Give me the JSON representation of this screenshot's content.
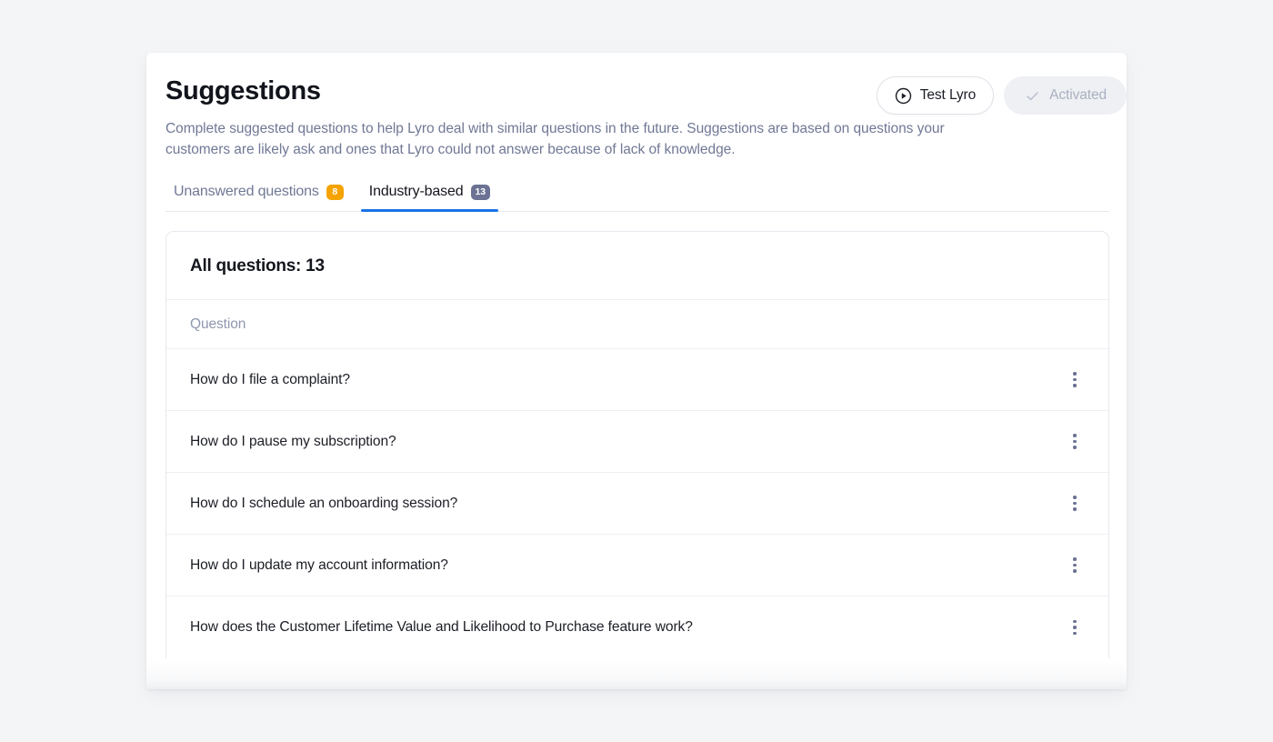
{
  "theme": {
    "page_background": "#f4f5f7",
    "accent": "#1a73e8",
    "badge_warning": "#f5a300",
    "badge_slate": "#6b7294",
    "text_primary": "#14161d",
    "text_muted": "#707895"
  },
  "header": {
    "title": "Suggestions",
    "description": "Complete suggested questions to help Lyro deal with similar questions in the future. Suggestions are based on questions your customers are likely ask and ones that Lyro could not answer because of lack of knowledge.",
    "actions": {
      "test": {
        "label": "Test Lyro",
        "icon": "play-circle-icon"
      },
      "activated": {
        "label": "Activated",
        "icon": "check-icon",
        "disabled": true
      }
    }
  },
  "tabs": [
    {
      "label": "Unanswered questions",
      "badge": "8",
      "badge_style": "warning",
      "active": false
    },
    {
      "label": "Industry-based",
      "badge": "13",
      "badge_style": "slate",
      "active": true
    }
  ],
  "table": {
    "title": "All questions: 13",
    "column_header": "Question",
    "rows": [
      {
        "question": "How do I file a complaint?",
        "menu_icon": "kebab-menu-icon"
      },
      {
        "question": "How do I pause my subscription?",
        "menu_icon": "kebab-menu-icon"
      },
      {
        "question": "How do I schedule an onboarding session?",
        "menu_icon": "kebab-menu-icon"
      },
      {
        "question": "How do I update my account information?",
        "menu_icon": "kebab-menu-icon"
      },
      {
        "question": "How does the Customer Lifetime Value and Likelihood to Purchase feature work?",
        "menu_icon": "kebab-menu-icon"
      }
    ]
  }
}
